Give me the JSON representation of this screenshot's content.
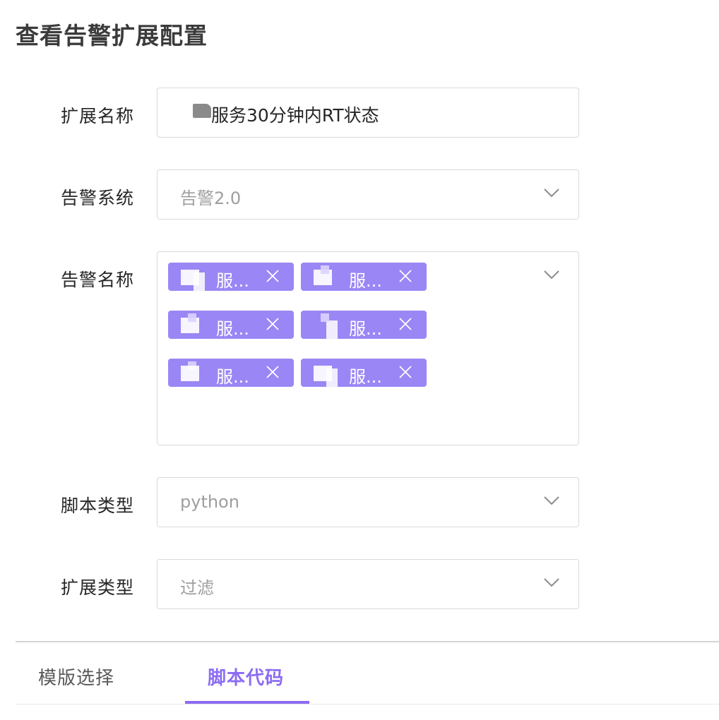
{
  "page": {
    "title": "查看告警扩展配置"
  },
  "form": {
    "extension_name": {
      "label": "扩展名称",
      "value": "服务30分钟内RT状态"
    },
    "alarm_system": {
      "label": "告警系统",
      "value": "告警2.0",
      "icon": "chevron-down-icon"
    },
    "alarm_names": {
      "label": "告警名称",
      "icon": "chevron-down-icon",
      "tags": [
        {
          "label": "服..."
        },
        {
          "label": "服..."
        },
        {
          "label": "服..."
        },
        {
          "label": "服..."
        },
        {
          "label": "服..."
        },
        {
          "label": "服..."
        }
      ]
    },
    "script_type": {
      "label": "脚本类型",
      "value": "python",
      "icon": "chevron-down-icon"
    },
    "extension_type": {
      "label": "扩展类型",
      "value": "过滤",
      "icon": "chevron-down-icon"
    }
  },
  "tabs": [
    {
      "label": "模版选择",
      "active": false
    },
    {
      "label": "脚本代码",
      "active": true
    }
  ],
  "colors": {
    "accent": "#8b6cf2",
    "tag_bg": "#9b86f5",
    "border": "#d9d9d9",
    "placeholder": "#9e9e9e"
  }
}
